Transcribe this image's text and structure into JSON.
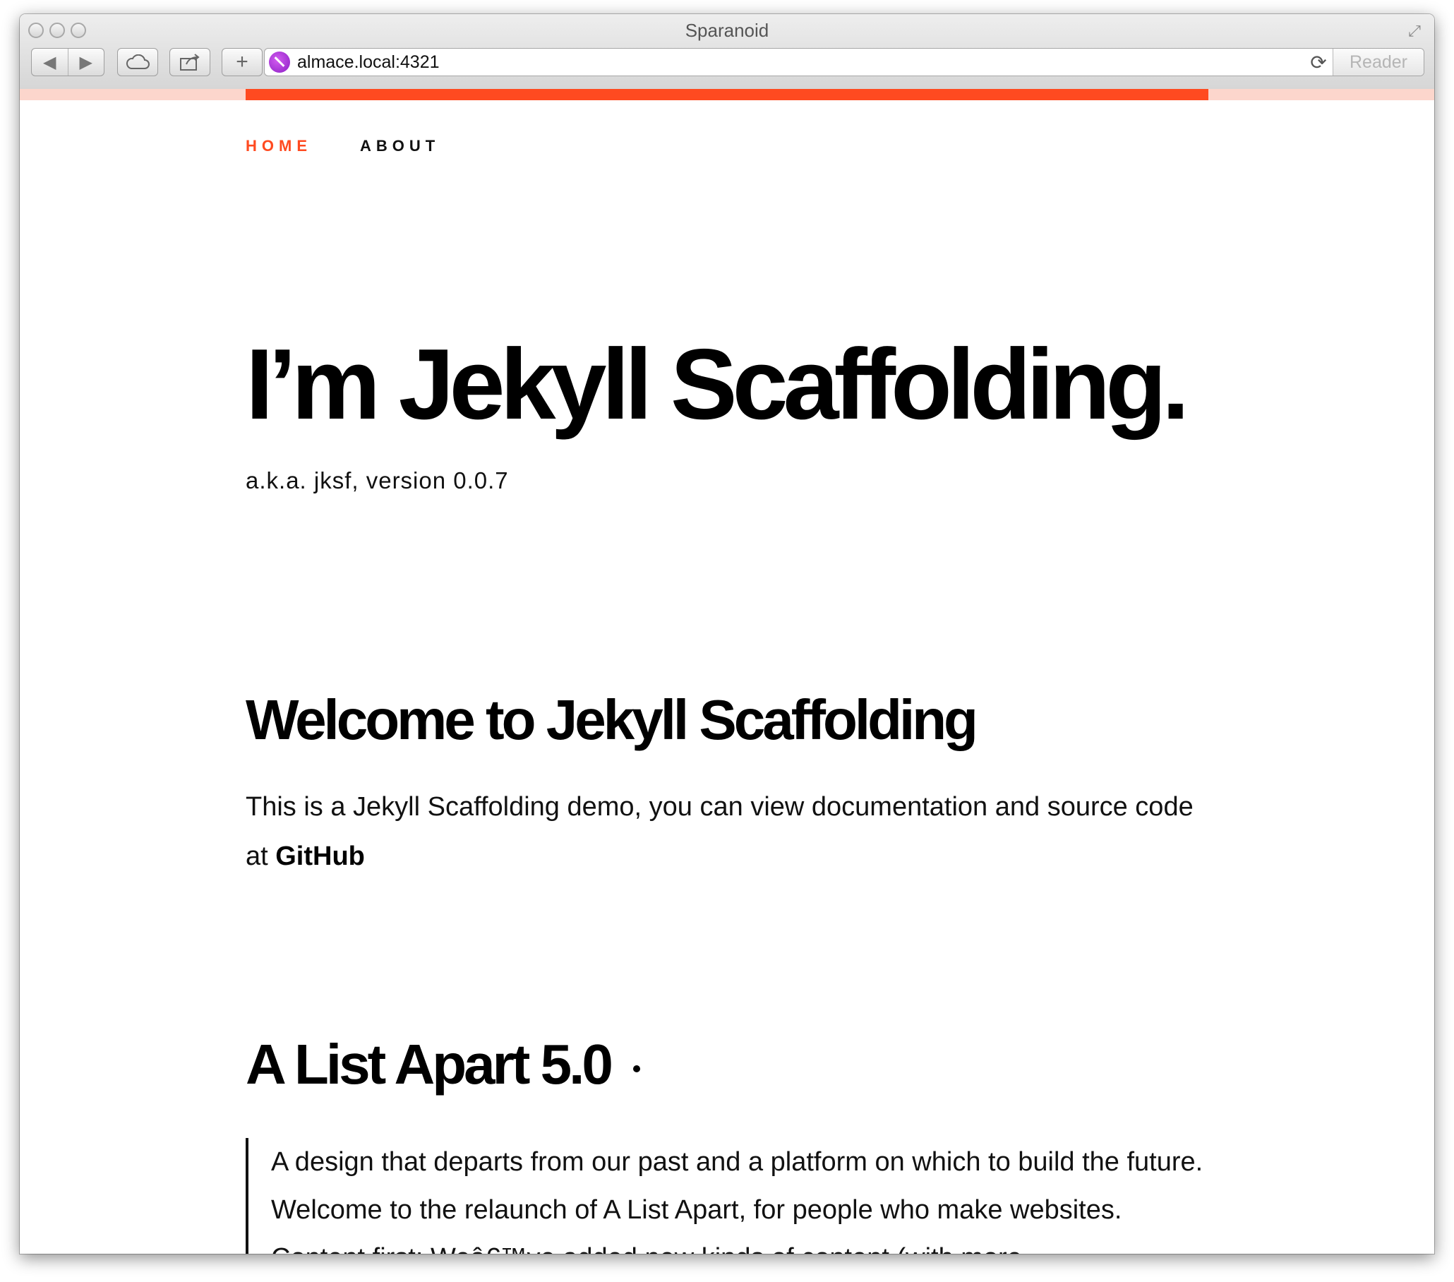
{
  "browser": {
    "window_title": "Sparanoid",
    "url": "almace.local:4321",
    "reader_label": "Reader",
    "icons": {
      "back": "back-arrow-icon",
      "forward": "forward-arrow-icon",
      "icloud": "cloud-icon",
      "share": "share-icon",
      "new_tab": "plus-icon",
      "reload": "reload-icon",
      "fullscreen": "fullscreen-icon",
      "favicon": "site-favicon"
    },
    "page_load_progress": 0.68
  },
  "nav": {
    "items": [
      {
        "label": "HOME",
        "active": true
      },
      {
        "label": "ABOUT",
        "active": false
      }
    ]
  },
  "hero": {
    "title": "I’m Jekyll Scaffolding.",
    "subtitle": "a.k.a. jksf, version 0.0.7"
  },
  "welcome": {
    "heading": "Welcome to Jekyll Scaffolding",
    "text": "This is a Jekyll Scaffolding demo, you can view documentation and source code at ",
    "link": "GitHub"
  },
  "post": {
    "title": "A List Apart 5.0",
    "excerpt": "A design that departs from our past and a platform on which to build the future. Welcome to the relaunch of A List Apart, for people who make websites. Content first: Weâ€™ve added new kinds of content (with more"
  },
  "colors": {
    "accent": "#ff4a20",
    "accent_light": "#fcd6cc",
    "text": "#111111"
  }
}
